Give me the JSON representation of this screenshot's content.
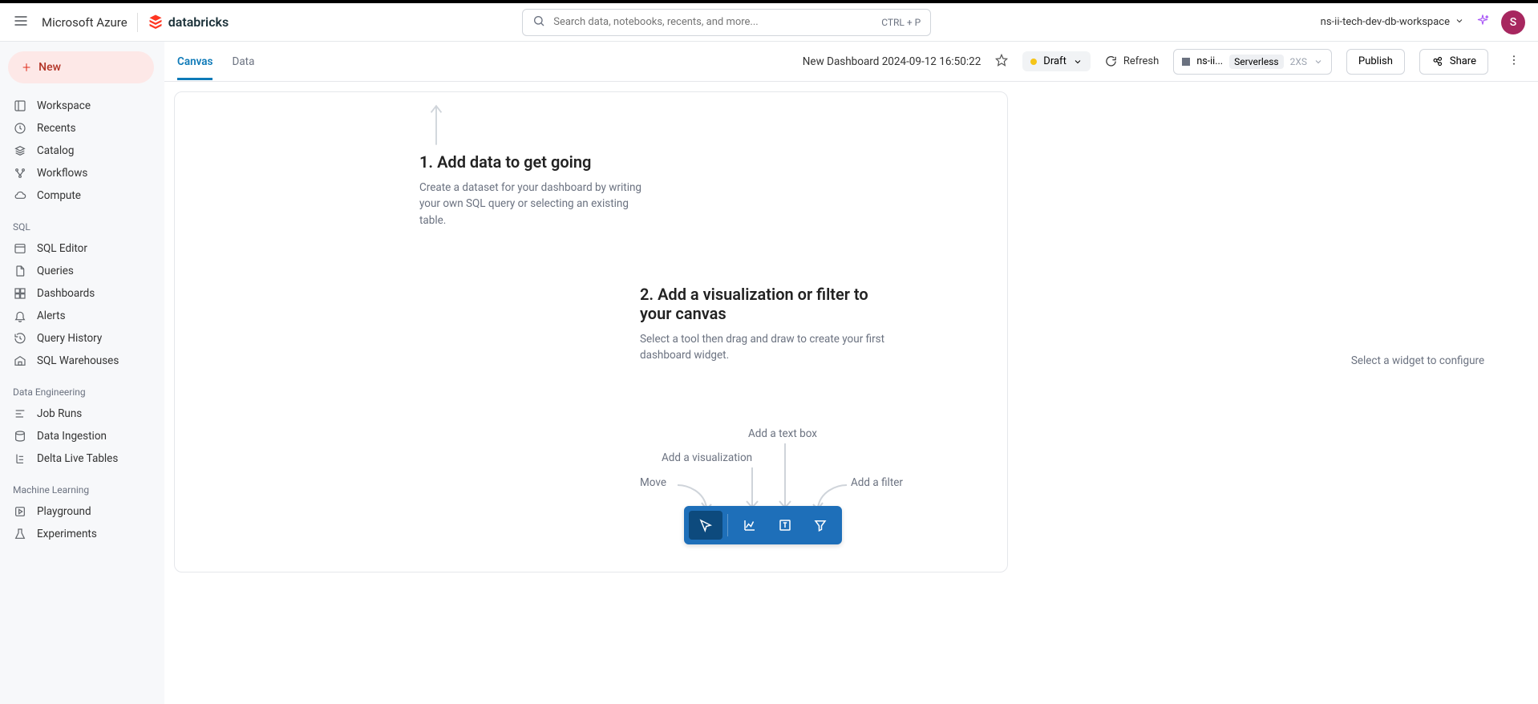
{
  "header": {
    "azure_brand": "Microsoft Azure",
    "db_brand": "databricks",
    "search_placeholder": "Search data, notebooks, recents, and more...",
    "search_shortcut": "CTRL + P",
    "workspace_name": "ns-ii-tech-dev-db-workspace",
    "avatar_initial": "S"
  },
  "sidebar": {
    "new_label": "New",
    "items1": [
      "Workspace",
      "Recents",
      "Catalog",
      "Workflows",
      "Compute"
    ],
    "section_sql": "SQL",
    "items2": [
      "SQL Editor",
      "Queries",
      "Dashboards",
      "Alerts",
      "Query History",
      "SQL Warehouses"
    ],
    "section_de": "Data Engineering",
    "items3": [
      "Job Runs",
      "Data Ingestion",
      "Delta Live Tables"
    ],
    "section_ml": "Machine Learning",
    "items4": [
      "Playground",
      "Experiments"
    ]
  },
  "page": {
    "tabs": {
      "canvas": "Canvas",
      "data": "Data"
    },
    "title": "New Dashboard 2024-09-12 16:50:22",
    "status_label": "Draft",
    "refresh_label": "Refresh",
    "compute_name": "ns-ii...",
    "serverless_tag": "Serverless",
    "size_tag": "2XS",
    "publish_label": "Publish",
    "share_label": "Share"
  },
  "canvas": {
    "step1_title": "1. Add data to get going",
    "step1_desc": "Create a dataset for your dashboard by writing your own SQL query or selecting an existing table.",
    "step2_title": "2. Add a visualization or filter to your canvas",
    "step2_desc": "Select a tool then drag and draw to create your first dashboard widget.",
    "tool_labels": {
      "move": "Move",
      "viz": "Add a visualization",
      "text": "Add a text box",
      "filter": "Add a filter"
    }
  },
  "properties": {
    "placeholder": "Select a widget to configure"
  }
}
